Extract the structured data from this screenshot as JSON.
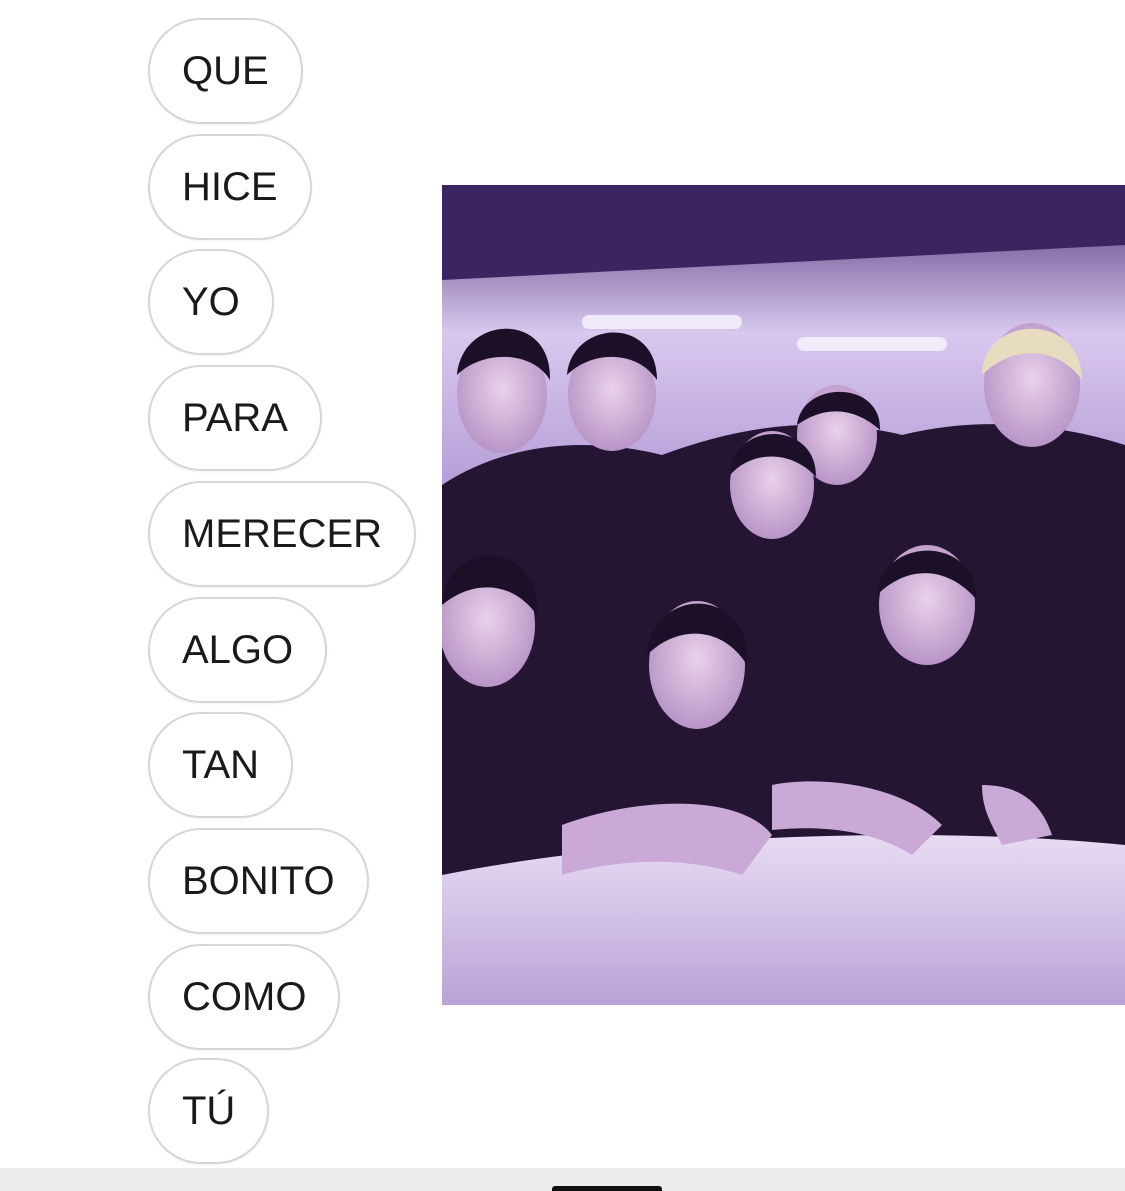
{
  "messages": [
    {
      "text": "QUE"
    },
    {
      "text": "HICE"
    },
    {
      "text": "YO"
    },
    {
      "text": "PARA"
    },
    {
      "text": "MERECER"
    },
    {
      "text": "ALGO"
    },
    {
      "text": "TAN"
    },
    {
      "text": "BONITO"
    },
    {
      "text": "COMO"
    },
    {
      "text": "TÚ"
    }
  ],
  "photo": {
    "description_icon": "group-photo-image",
    "tint_color": "#7a5aa8"
  },
  "colors": {
    "bubble_border": "#d6d6d6",
    "bubble_text": "#1a1a1a",
    "background": "#ffffff"
  }
}
